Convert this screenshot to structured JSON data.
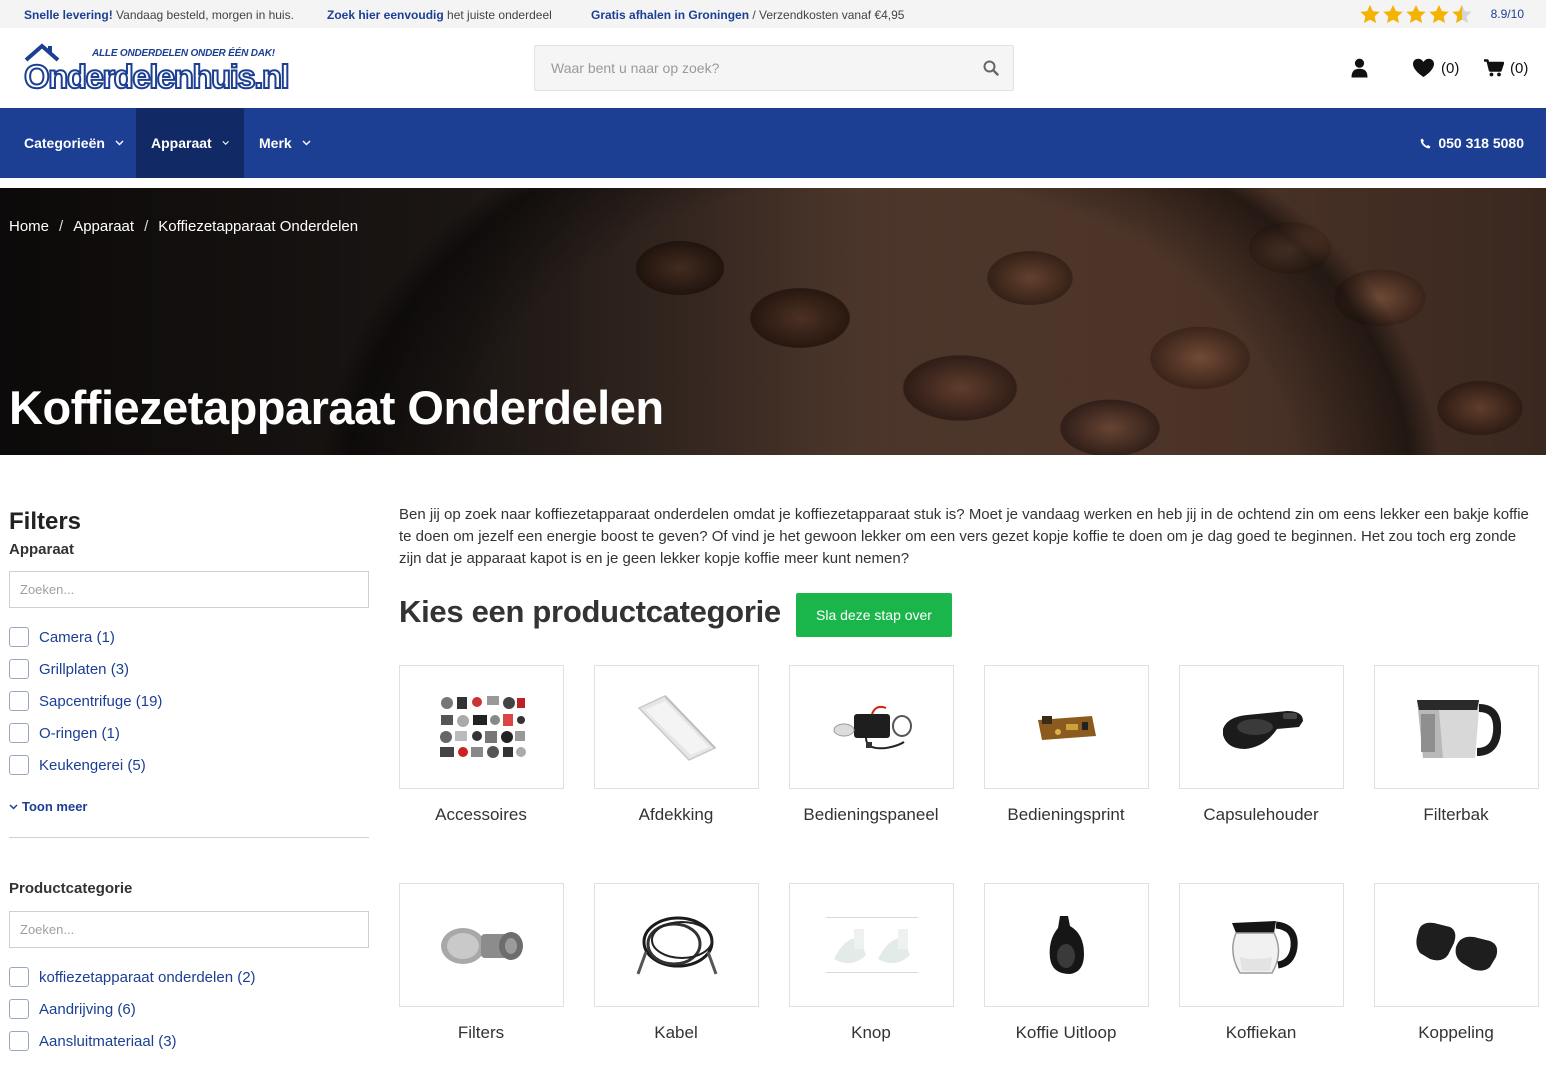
{
  "topbar": {
    "usp1_bold": "Snelle levering!",
    "usp1_text": " Vandaag besteld, morgen in huis.",
    "usp2_bold": "Zoek hier eenvoudig",
    "usp2_text": " het juiste onderdeel",
    "usp3_bold": "Gratis afhalen in Groningen",
    "usp3_text": " / Verzendkosten vanaf €4,95",
    "rating_stars": 4.5,
    "rating_score": "8.9/10"
  },
  "header": {
    "logo_tagline": "ALLE ONDERDELEN ONDER ÉÉN DAK!",
    "logo_text": "Onderdelenhuis.nl",
    "search_placeholder": "Waar bent u naar op zoek?",
    "wishlist_count": "(0)",
    "cart_count": "(0)"
  },
  "nav": {
    "items": [
      {
        "label": "Categorieën"
      },
      {
        "label": "Apparaat"
      },
      {
        "label": "Merk"
      }
    ],
    "phone": "050 318 5080"
  },
  "hero": {
    "breadcrumb": [
      "Home",
      "Apparaat",
      "Koffiezetapparaat Onderdelen"
    ],
    "title": "Koffiezetapparaat Onderdelen"
  },
  "sidebar": {
    "title": "Filters",
    "groups": [
      {
        "title": "Apparaat",
        "search_placeholder": "Zoeken...",
        "options": [
          "Camera (1)",
          "Grillplaten (3)",
          "Sapcentrifuge (19)",
          "O-ringen (1)",
          "Keukengerei (5)"
        ],
        "show_more": "Toon meer"
      },
      {
        "title": "Productcategorie",
        "search_placeholder": "Zoeken...",
        "options": [
          "koffiezetapparaat onderdelen (2)",
          "Aandrijving (6)",
          "Aansluitmateriaal (3)"
        ]
      }
    ]
  },
  "main": {
    "intro": "Ben jij op zoek naar koffiezetapparaat onderdelen omdat je koffiezetapparaat stuk is? Moet je vandaag werken en heb jij in de ochtend zin om eens lekker een bakje koffie te doen om jezelf een energie boost te geven? Of vind je het gewoon lekker om een vers gezet kopje koffie te doen om je dag goed te beginnen. Het zou toch erg zonde zijn dat je apparaat kapot is en je geen lekker kopje koffie meer kunt nemen?",
    "category_heading": "Kies een productcategorie",
    "skip_button": "Sla deze stap over",
    "categories": [
      {
        "label": "Accessoires"
      },
      {
        "label": "Afdekking"
      },
      {
        "label": "Bedieningspaneel"
      },
      {
        "label": "Bedieningsprint"
      },
      {
        "label": "Capsulehouder"
      },
      {
        "label": "Filterbak"
      },
      {
        "label": "Filters"
      },
      {
        "label": "Kabel"
      },
      {
        "label": "Knop"
      },
      {
        "label": "Koffie Uitloop"
      },
      {
        "label": "Koffiekan"
      },
      {
        "label": "Koppeling"
      }
    ]
  },
  "colors": {
    "brand_blue": "#1c3f94",
    "nav_active": "#112a66",
    "skip_green": "#1ab64b",
    "star_gold": "#f5b301"
  }
}
